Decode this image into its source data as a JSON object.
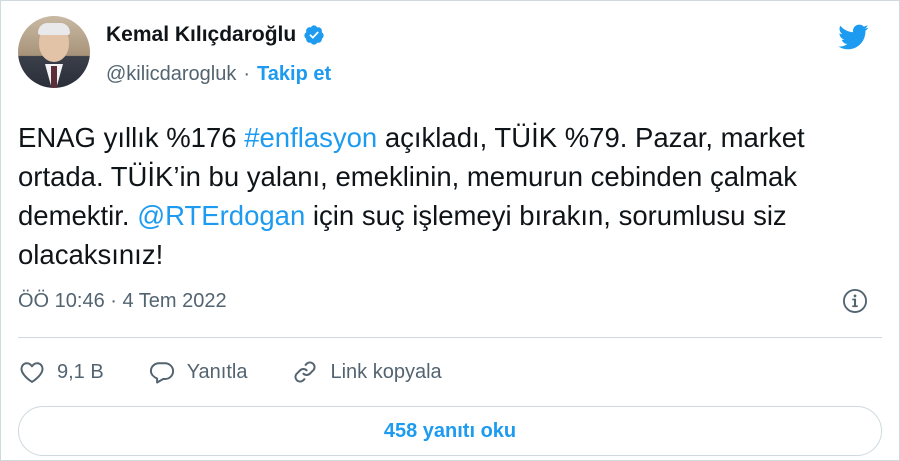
{
  "author": {
    "display_name": "Kemal Kılıçdaroğlu",
    "handle": "@kilicdarogluk",
    "separator": "·",
    "follow_label": "Takip et"
  },
  "tweet": {
    "text_parts": [
      "ENAG yıllık %176 ",
      "#enflasyon",
      " açıkladı, TÜİK %79. Pazar, market ortada. TÜİK’in bu yalanı, emeklinin, memurun cebinden çalmak demektir. ",
      "@RTErdogan",
      " için suç işlemeyi bırakın, sorumlusu siz olacaksınız!"
    ],
    "timestamp": "ÖÖ 10:46 · 4 Tem 2022"
  },
  "actions": {
    "likes": "9,1 B",
    "reply_label": "Yanıtla",
    "copy_link_label": "Link kopyala"
  },
  "replies_button_label": "458 yanıtı oku",
  "colors": {
    "accent": "#1d9bf0",
    "secondary_text": "#536471",
    "border": "#cfd9de",
    "primary_text": "#0f1419"
  },
  "icons": [
    "verified-badge-icon",
    "twitter-bird-icon",
    "info-icon",
    "heart-icon",
    "reply-icon",
    "link-icon"
  ]
}
